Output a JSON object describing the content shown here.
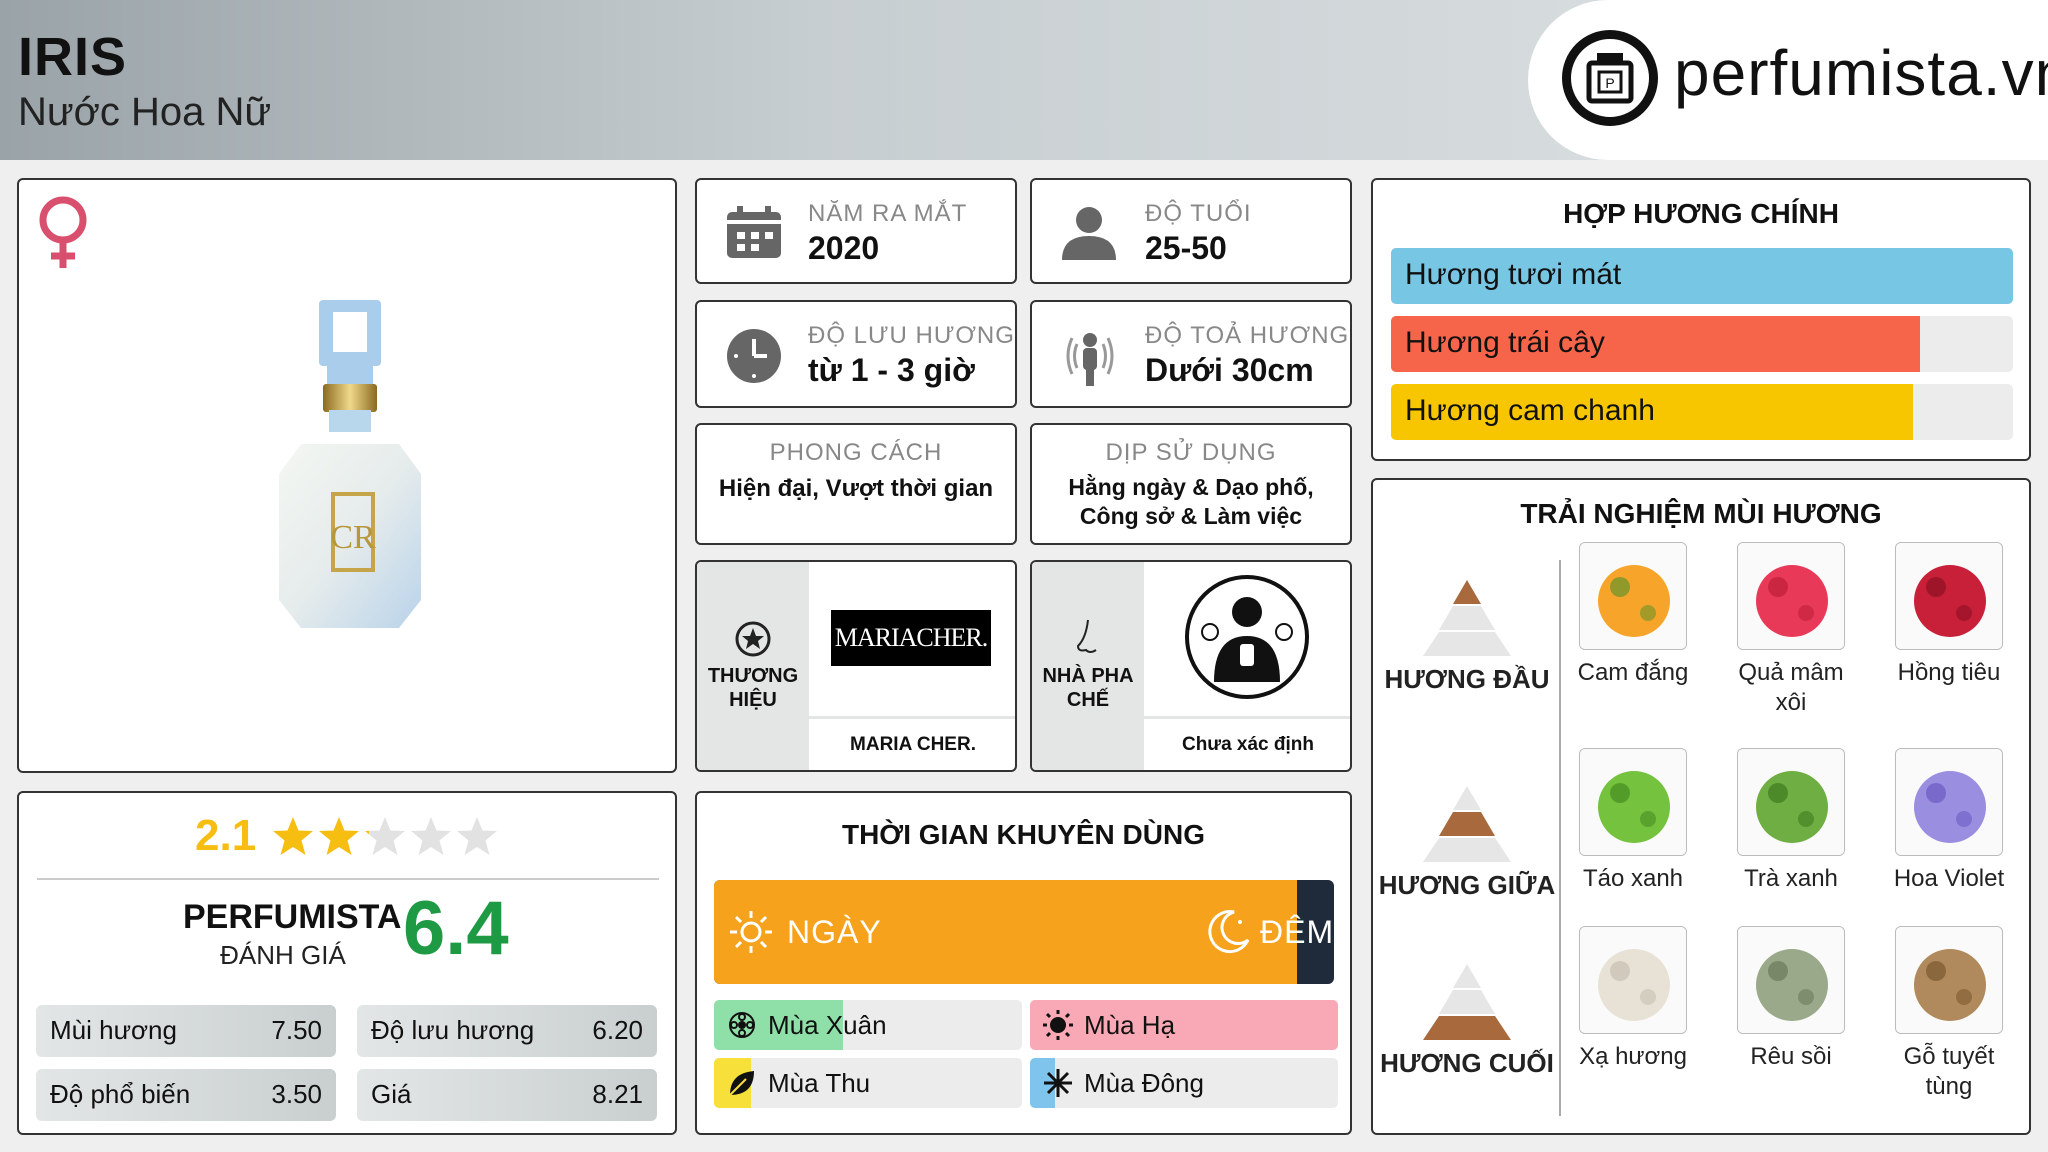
{
  "header": {
    "title": "IRIS",
    "subtitle": "Nước Hoa Nữ",
    "brand_site": "perfumista.vn"
  },
  "info": {
    "release": {
      "label": "NĂM RA MẮT",
      "value": "2020"
    },
    "age": {
      "label": "ĐỘ TUỔI",
      "value": "25-50"
    },
    "longevity": {
      "label": "ĐỘ LƯU HƯƠNG",
      "value": "từ 1 - 3 giờ"
    },
    "sillage": {
      "label": "ĐỘ TOẢ HƯƠNG",
      "value": "Dưới 30cm"
    },
    "style": {
      "label": "PHONG CÁCH",
      "value": "Hiện đại, Vượt thời gian"
    },
    "occasion": {
      "label": "DỊP SỬ DỤNG",
      "value": "Hằng ngày & Dạo phố, Công sở & Làm việc"
    },
    "brand": {
      "label": "THƯƠNG HIỆU",
      "logo_text": "MARIACHER.",
      "name": "MARIA CHER."
    },
    "perfumer": {
      "label": "NHÀ PHA CHẾ",
      "name": "Chưa xác định"
    }
  },
  "accords": {
    "title": "HỢP HƯƠNG CHÍNH",
    "items": [
      {
        "label": "Hương tươi mát",
        "level": 1.0,
        "color": "#76c6e4"
      },
      {
        "label": "Hương trái cây",
        "level": 0.85,
        "color": "#f6654a"
      },
      {
        "label": "Hương cam chanh",
        "level": 0.84,
        "color": "#f8c600"
      }
    ]
  },
  "notes": {
    "title": "TRẢI NGHIỆM MÙI HƯƠNG",
    "tiers": [
      {
        "label": "HƯƠNG ĐẦU",
        "items": [
          "Cam đắng",
          "Quả mâm xôi",
          "Hồng tiêu"
        ]
      },
      {
        "label": "HƯƠNG GIỮA",
        "items": [
          "Táo xanh",
          "Trà xanh",
          "Hoa Violet"
        ]
      },
      {
        "label": "HƯƠNG CUỐI",
        "items": [
          "Xạ hương",
          "Rêu sồi",
          "Gỗ tuyết tùng"
        ]
      }
    ]
  },
  "rating": {
    "stars_value": "2.1",
    "stars": 2.1,
    "brand_label": "PERFUMISTA",
    "eval_label": "ĐÁNH GIÁ",
    "score": "6.4",
    "scores": [
      {
        "label": "Mùi hương",
        "value": "7.50"
      },
      {
        "label": "Độ lưu hương",
        "value": "6.20"
      },
      {
        "label": "Độ phổ biến",
        "value": "3.50"
      },
      {
        "label": "Giá",
        "value": "8.21"
      }
    ]
  },
  "time": {
    "title": "THỜI GIAN KHUYÊN DÙNG",
    "day_label": "NGÀY",
    "night_label": "ĐÊM",
    "day_fraction": 0.94,
    "seasons": [
      {
        "label": "Mùa Xuân",
        "level": 0.42,
        "color": "#8fe0a8"
      },
      {
        "label": "Mùa Hạ",
        "level": 1.0,
        "color": "#f9a9b5"
      },
      {
        "label": "Mùa Thu",
        "level": 0.12,
        "color": "#f8e03a"
      },
      {
        "label": "Mùa Đông",
        "level": 0.08,
        "color": "#7fc4ec"
      }
    ]
  },
  "colors": {
    "accent": "#f6a21c",
    "green_score": "#1e9a45",
    "star": "#f7be12",
    "female": "#d94f6e"
  }
}
